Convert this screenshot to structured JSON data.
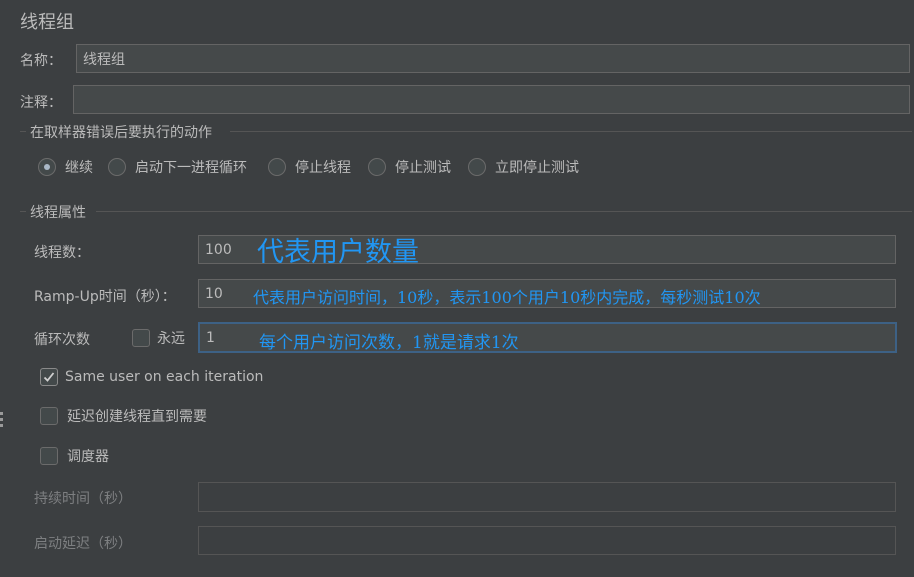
{
  "title": "线程组",
  "name": {
    "label": "名称：",
    "value": "线程组"
  },
  "comment": {
    "label": "注释：",
    "value": ""
  },
  "sampler_error": {
    "legend": "在取样器错误后要执行的动作",
    "options": [
      "继续",
      "启动下一进程循环",
      "停止线程",
      "停止测试",
      "立即停止测试"
    ],
    "selected": "继续"
  },
  "thread_props": {
    "legend": "线程属性",
    "threads_label": "线程数：",
    "threads_value": "100",
    "threads_note": "代表用户数量",
    "rampup_label": "Ramp-Up时间（秒）：",
    "rampup_value": "10",
    "rampup_note": "代表用户访问时间，10秒，表示100个用户10秒内完成，每秒测试10次",
    "loop_label": "循环次数",
    "forever_label": "永远",
    "forever_checked": false,
    "loop_value": "1",
    "loop_note": "每个用户访问次数，1就是请求1次",
    "same_user_label": "Same user on each iteration",
    "same_user_checked": true,
    "delay_label": "延迟创建线程直到需要",
    "delay_checked": false,
    "scheduler_label": "调度器",
    "scheduler_checked": false,
    "duration_label": "持续时间（秒）",
    "duration_value": "",
    "startup_delay_label": "启动延迟（秒）",
    "startup_delay_value": ""
  },
  "colors": {
    "background": "#3c3f41",
    "field": "#45494a",
    "annotation": "#2196f3",
    "focus_border": "#3d6185"
  }
}
